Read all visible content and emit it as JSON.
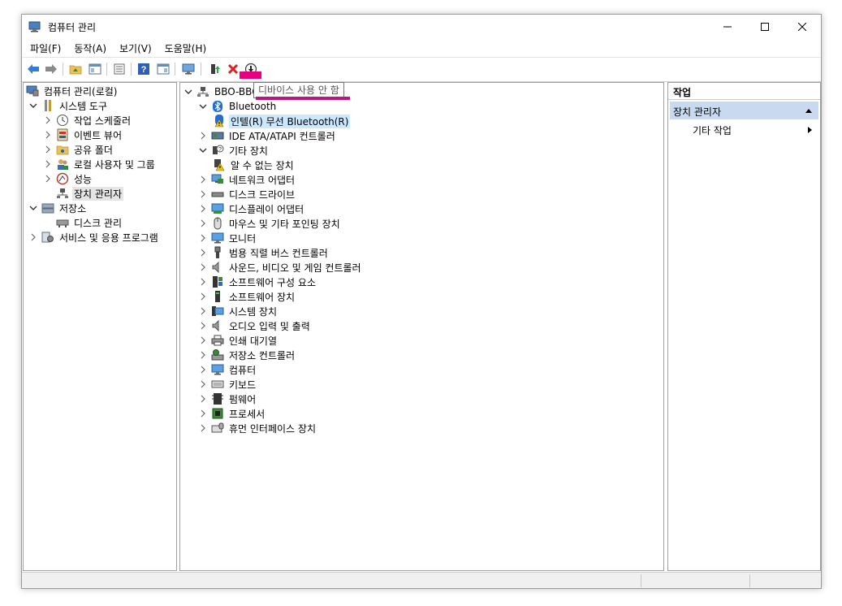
{
  "window": {
    "title": "컴퓨터 관리"
  },
  "menu": [
    "파일(F)",
    "동작(A)",
    "보기(V)",
    "도움말(H)"
  ],
  "tooltip": "디바이스 사용 안 함",
  "left_tree": [
    {
      "label": "컴퓨터 관리(로컬)",
      "icon": "computer-management-icon"
    },
    {
      "label": "시스템 도구",
      "icon": "tools-icon"
    },
    {
      "label": "작업 스케줄러",
      "icon": "clock-icon"
    },
    {
      "label": "이벤트 뷰어",
      "icon": "event-viewer-icon"
    },
    {
      "label": "공유 폴더",
      "icon": "shared-folder-icon"
    },
    {
      "label": "로컬 사용자 및 그룹",
      "icon": "users-icon"
    },
    {
      "label": "성능",
      "icon": "performance-icon"
    },
    {
      "label": "장치 관리자",
      "icon": "device-manager-icon"
    },
    {
      "label": "저장소",
      "icon": "storage-icon"
    },
    {
      "label": "디스크 관리",
      "icon": "disk-icon"
    },
    {
      "label": "서비스 및 응용 프로그램",
      "icon": "services-icon"
    }
  ],
  "device_tree": {
    "root": "BBO-BBO",
    "items": [
      {
        "label": "Bluetooth",
        "icon": "bluetooth-icon"
      },
      {
        "label": "인텔(R) 무선 Bluetooth(R)",
        "icon": "bluetooth-warning-icon"
      },
      {
        "label": "IDE ATA/ATAPI 컨트롤러",
        "icon": "ide-controller-icon"
      },
      {
        "label": "기타 장치",
        "icon": "other-devices-icon"
      },
      {
        "label": "알 수 없는 장치",
        "icon": "unknown-device-warning-icon"
      },
      {
        "label": "네트워크 어댑터",
        "icon": "network-adapter-icon"
      },
      {
        "label": "디스크 드라이브",
        "icon": "disk-drive-icon"
      },
      {
        "label": "디스플레이 어댑터",
        "icon": "display-adapter-icon"
      },
      {
        "label": "마우스 및 기타 포인팅 장치",
        "icon": "mouse-icon"
      },
      {
        "label": "모니터",
        "icon": "monitor-icon"
      },
      {
        "label": "범용 직렬 버스 컨트롤러",
        "icon": "usb-icon"
      },
      {
        "label": "사운드, 비디오 및 게임 컨트롤러",
        "icon": "sound-icon"
      },
      {
        "label": "소프트웨어 구성 요소",
        "icon": "software-component-icon"
      },
      {
        "label": "소프트웨어 장치",
        "icon": "software-device-icon"
      },
      {
        "label": "시스템 장치",
        "icon": "system-device-icon"
      },
      {
        "label": "오디오 입력 및 출력",
        "icon": "audio-icon"
      },
      {
        "label": "인쇄 대기열",
        "icon": "printer-icon"
      },
      {
        "label": "저장소 컨트롤러",
        "icon": "storage-controller-icon"
      },
      {
        "label": "컴퓨터",
        "icon": "computer-icon"
      },
      {
        "label": "키보드",
        "icon": "keyboard-icon"
      },
      {
        "label": "펌웨어",
        "icon": "firmware-icon"
      },
      {
        "label": "프로세서",
        "icon": "processor-icon"
      },
      {
        "label": "휴먼 인터페이스 장치",
        "icon": "hid-icon"
      }
    ]
  },
  "actions": {
    "header": "작업",
    "section": "장치 관리자",
    "item": "기타 작업"
  },
  "colors": {
    "selection": "#cce8ff",
    "action_section": "#c9d9ef",
    "highlight": "#e6007e"
  }
}
